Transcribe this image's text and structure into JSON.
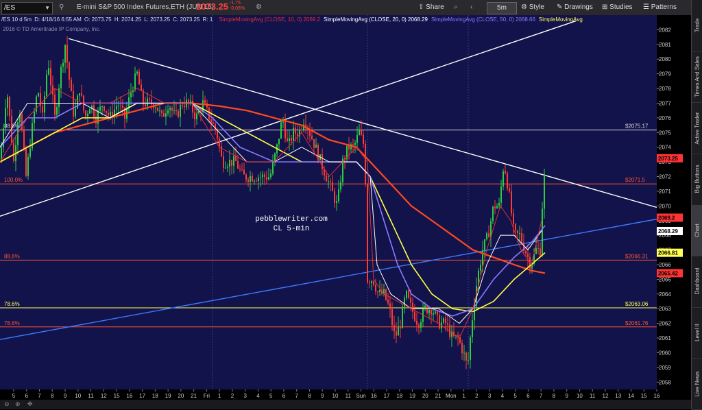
{
  "toolbar": {
    "symbol": "/ES",
    "description": "E-mini S&P 500 Index Futures,ETH (JUN 16)",
    "last_price": "2073.25",
    "change": "-1.75",
    "change_pct": "-0.08%",
    "share_label": "Share",
    "timeframe": "5m",
    "style_label": "Style",
    "drawings_label": "Drawings",
    "studies_label": "Studies",
    "patterns_label": "Patterns",
    "colors": {
      "price": "#ff4040",
      "background": "#2a2a2e"
    }
  },
  "info_bar": {
    "period": "/ES 10 d 5m",
    "date": "D: 4/18/16 6:55 AM",
    "open": "O: 2073.75",
    "high": "H: 2074.25",
    "low": "L: 2073.25",
    "close": "C: 2073.25",
    "r": "R: 1",
    "studies": [
      {
        "label": "SimpleMovingAvg (CLOSE, 10, 0)",
        "value": "2069.2",
        "color": "#e03030"
      },
      {
        "label": "SimpleMovingAvg (CLOSE, 20, 0)",
        "value": "2068.29",
        "color": "#ffffff"
      },
      {
        "label": "SimpleMovingAvg (CLOSE, 50, 0)",
        "value": "2068.66",
        "color": "#8a7aff"
      },
      {
        "label": "SimpleMovingAvg",
        "value": "",
        "color": "#ffff55"
      }
    ]
  },
  "copyright": "2016 © TD Ameritrade IP Company, Inc.",
  "watermark": {
    "line1": "pebblewriter.com",
    "line2": "CL 5-min"
  },
  "sidebar": {
    "tabs": [
      "Trade",
      "Times And Sales",
      "Active Trader",
      "Big Buttons",
      "Chart",
      "Dashboard",
      "Level II",
      "Live News"
    ]
  },
  "chart_data": {
    "type": "candlestick",
    "ylim": [
      2057.5,
      2083
    ],
    "yticks": [
      2058,
      2059,
      2060,
      2061,
      2062,
      2063,
      2064,
      2065,
      2066,
      2067,
      2068,
      2069,
      2070,
      2071,
      2072,
      2073,
      2074,
      2075,
      2076,
      2077,
      2078,
      2079,
      2080,
      2081,
      2082
    ],
    "xticks": [
      "5",
      "6",
      "7",
      "8",
      "9",
      "10",
      "11",
      "12",
      "15",
      "16",
      "17",
      "18",
      "19",
      "20",
      "21",
      "Fri",
      "1",
      "2",
      "3",
      "4",
      "5",
      "6",
      "7",
      "8",
      "9",
      "10",
      "11",
      "Sun",
      "16",
      "17",
      "18",
      "19",
      "20",
      "21",
      "Mon",
      "1",
      "2",
      "3",
      "4",
      "5",
      "6",
      "7",
      "8",
      "9",
      "10",
      "11",
      "12",
      "13",
      "14",
      "15",
      "16"
    ],
    "price_levels": [
      {
        "label": "88.6%",
        "value": 2075.17,
        "tag": "$2075.17",
        "color": "#d8d8d8"
      },
      {
        "label": "100.0%",
        "value": 2071.5,
        "tag": "$2071.5",
        "color": "#ff5533"
      },
      {
        "label": "88.6%",
        "value": 2066.31,
        "tag": "$2066.31",
        "color": "#ff5533"
      },
      {
        "label": "78.6%",
        "value": 2063.06,
        "tag": "$2063.06",
        "color": "#ffff55"
      },
      {
        "label": "78.6%",
        "value": 2061.76,
        "tag": "$2061.76",
        "color": "#ff5533"
      }
    ],
    "value_tags": [
      {
        "value": 2073.25,
        "text": "2073.25",
        "color": "#ff3333"
      },
      {
        "value": 2069.2,
        "text": "2069.2",
        "color": "#ff3333"
      },
      {
        "value": 2068.29,
        "text": "2068.29",
        "color": "#ffffff"
      },
      {
        "value": 2066.81,
        "text": "2066.81",
        "color": "#ffff55"
      },
      {
        "value": 2065.42,
        "text": "2065.42",
        "color": "#ff3333"
      }
    ],
    "price_path": [
      [
        0,
        2073
      ],
      [
        10,
        2078
      ],
      [
        20,
        2073
      ],
      [
        28,
        2077
      ],
      [
        38,
        2072
      ],
      [
        46,
        2075
      ],
      [
        55,
        2078
      ],
      [
        62,
        2076
      ],
      [
        70,
        2080
      ],
      [
        80,
        2076
      ],
      [
        88,
        2079
      ],
      [
        95,
        2081
      ],
      [
        100,
        2079
      ],
      [
        108,
        2076
      ],
      [
        116,
        2078
      ],
      [
        124,
        2076
      ],
      [
        132,
        2077
      ],
      [
        140,
        2076
      ],
      [
        150,
        2077
      ],
      [
        160,
        2076
      ],
      [
        172,
        2077
      ],
      [
        182,
        2076
      ],
      [
        192,
        2078
      ],
      [
        200,
        2079
      ],
      [
        208,
        2077
      ],
      [
        216,
        2077
      ],
      [
        226,
        2077
      ],
      [
        236,
        2076
      ],
      [
        246,
        2077
      ],
      [
        256,
        2076
      ],
      [
        266,
        2077
      ],
      [
        276,
        2077
      ],
      [
        286,
        2076
      ],
      [
        296,
        2077
      ],
      [
        306,
        2076
      ],
      [
        316,
        2075
      ],
      [
        324,
        2073
      ],
      [
        334,
        2073
      ],
      [
        344,
        2073
      ],
      [
        354,
        2072
      ],
      [
        364,
        2072
      ],
      [
        374,
        2072
      ],
      [
        384,
        2072
      ],
      [
        394,
        2072
      ],
      [
        404,
        2074
      ],
      [
        412,
        2076
      ],
      [
        420,
        2074
      ],
      [
        428,
        2075
      ],
      [
        436,
        2075
      ],
      [
        444,
        2076
      ],
      [
        452,
        2075
      ],
      [
        460,
        2074
      ],
      [
        468,
        2073
      ],
      [
        476,
        2072
      ],
      [
        484,
        2071
      ],
      [
        492,
        2070
      ],
      [
        500,
        2073
      ],
      [
        508,
        2074
      ],
      [
        516,
        2074
      ],
      [
        524,
        2075
      ],
      [
        532,
        2074
      ],
      [
        536,
        2065
      ],
      [
        544,
        2065
      ],
      [
        552,
        2064
      ],
      [
        560,
        2064
      ],
      [
        568,
        2063
      ],
      [
        576,
        2061
      ],
      [
        584,
        2062
      ],
      [
        592,
        2064
      ],
      [
        600,
        2063
      ],
      [
        610,
        2062
      ],
      [
        620,
        2063
      ],
      [
        630,
        2063
      ],
      [
        640,
        2062
      ],
      [
        650,
        2062
      ],
      [
        660,
        2061
      ],
      [
        668,
        2061
      ],
      [
        676,
        2060
      ],
      [
        682,
        2059
      ],
      [
        688,
        2062
      ],
      [
        696,
        2065
      ],
      [
        704,
        2067
      ],
      [
        712,
        2068
      ],
      [
        720,
        2070
      ],
      [
        728,
        2070
      ],
      [
        735,
        2073
      ],
      [
        742,
        2071
      ],
      [
        750,
        2068
      ],
      [
        758,
        2068
      ],
      [
        766,
        2067
      ],
      [
        774,
        2066
      ],
      [
        782,
        2067
      ],
      [
        788,
        2067
      ],
      [
        792,
        2071
      ],
      [
        796,
        2073
      ]
    ],
    "ma_10": [
      [
        0,
        2073
      ],
      [
        40,
        2076
      ],
      [
        80,
        2078
      ],
      [
        120,
        2077
      ],
      [
        160,
        2077
      ],
      [
        200,
        2078
      ],
      [
        240,
        2077
      ],
      [
        280,
        2077
      ],
      [
        320,
        2074
      ],
      [
        360,
        2073
      ],
      [
        400,
        2073
      ],
      [
        440,
        2075
      ],
      [
        480,
        2072
      ],
      [
        520,
        2074
      ],
      [
        536,
        2073
      ],
      [
        545,
        2065
      ],
      [
        560,
        2064
      ],
      [
        600,
        2063
      ],
      [
        640,
        2062
      ],
      [
        670,
        2061
      ],
      [
        690,
        2063
      ],
      [
        710,
        2067
      ],
      [
        730,
        2070
      ],
      [
        745,
        2069
      ],
      [
        760,
        2067
      ],
      [
        775,
        2066
      ],
      [
        790,
        2069
      ]
    ],
    "ma_20": [
      [
        0,
        2074
      ],
      [
        40,
        2077
      ],
      [
        80,
        2077
      ],
      [
        120,
        2077
      ],
      [
        160,
        2076
      ],
      [
        200,
        2077
      ],
      [
        240,
        2077
      ],
      [
        280,
        2077
      ],
      [
        320,
        2075
      ],
      [
        360,
        2073
      ],
      [
        400,
        2073
      ],
      [
        440,
        2074
      ],
      [
        480,
        2073
      ],
      [
        520,
        2073
      ],
      [
        540,
        2072
      ],
      [
        550,
        2066
      ],
      [
        570,
        2064
      ],
      [
        600,
        2063
      ],
      [
        640,
        2063
      ],
      [
        670,
        2062
      ],
      [
        690,
        2063
      ],
      [
        710,
        2066
      ],
      [
        730,
        2068
      ],
      [
        750,
        2068
      ],
      [
        770,
        2067
      ],
      [
        790,
        2068.3
      ]
    ],
    "ma_50": [
      [
        0,
        2074
      ],
      [
        40,
        2076
      ],
      [
        80,
        2076
      ],
      [
        120,
        2077
      ],
      [
        160,
        2077
      ],
      [
        200,
        2077
      ],
      [
        240,
        2077
      ],
      [
        280,
        2077
      ],
      [
        310,
        2076
      ],
      [
        350,
        2074
      ],
      [
        400,
        2073
      ],
      [
        440,
        2073
      ],
      [
        480,
        2073
      ],
      [
        520,
        2073
      ],
      [
        540,
        2072
      ],
      [
        560,
        2069
      ],
      [
        580,
        2066
      ],
      [
        600,
        2064
      ],
      [
        630,
        2063
      ],
      [
        660,
        2062.5
      ],
      [
        690,
        2063
      ],
      [
        720,
        2065
      ],
      [
        750,
        2066.5
      ],
      [
        775,
        2067.5
      ],
      [
        795,
        2068.66
      ]
    ],
    "ma_yellow": [
      [
        0,
        2073
      ],
      [
        40,
        2074
      ],
      [
        80,
        2075
      ],
      [
        120,
        2076
      ],
      [
        160,
        2076
      ],
      [
        200,
        2077
      ],
      [
        240,
        2077
      ],
      [
        280,
        2077
      ],
      [
        320,
        2076
      ],
      [
        360,
        2075
      ],
      [
        400,
        2074
      ],
      [
        440,
        2073
      ],
      [
        480,
        2073
      ],
      [
        520,
        2073
      ],
      [
        540,
        2072
      ],
      [
        560,
        2070
      ],
      [
        580,
        2068
      ],
      [
        600,
        2066
      ],
      [
        630,
        2064
      ],
      [
        660,
        2063
      ],
      [
        690,
        2062.8
      ],
      [
        720,
        2063.5
      ],
      [
        750,
        2065
      ],
      [
        775,
        2066
      ],
      [
        795,
        2066.81
      ]
    ],
    "ma_orange": [
      [
        0,
        2073
      ],
      [
        40,
        2074
      ],
      [
        80,
        2075
      ],
      [
        120,
        2075.5
      ],
      [
        160,
        2076
      ],
      [
        200,
        2076.5
      ],
      [
        240,
        2077
      ],
      [
        280,
        2077
      ],
      [
        320,
        2076.8
      ],
      [
        360,
        2076.5
      ],
      [
        400,
        2076
      ],
      [
        440,
        2075.5
      ],
      [
        480,
        2074.5
      ],
      [
        520,
        2074
      ],
      [
        540,
        2073
      ],
      [
        560,
        2072
      ],
      [
        580,
        2071
      ],
      [
        600,
        2070
      ],
      [
        630,
        2069
      ],
      [
        660,
        2068
      ],
      [
        690,
        2067
      ],
      [
        720,
        2066.5
      ],
      [
        750,
        2066
      ],
      [
        775,
        2065.6
      ],
      [
        795,
        2065.42
      ]
    ],
    "trendlines": [
      {
        "from": [
          100,
          2081.4
        ],
        "to": [
          958,
          2069.9
        ],
        "color": "#ffffff"
      },
      {
        "from": [
          0,
          2069.3
        ],
        "to": [
          840,
          2082.6
        ],
        "color": "#ffffff"
      },
      {
        "from": [
          0,
          2060.9
        ],
        "to": [
          958,
          2069.1
        ],
        "color": "#3a7bff"
      }
    ]
  }
}
